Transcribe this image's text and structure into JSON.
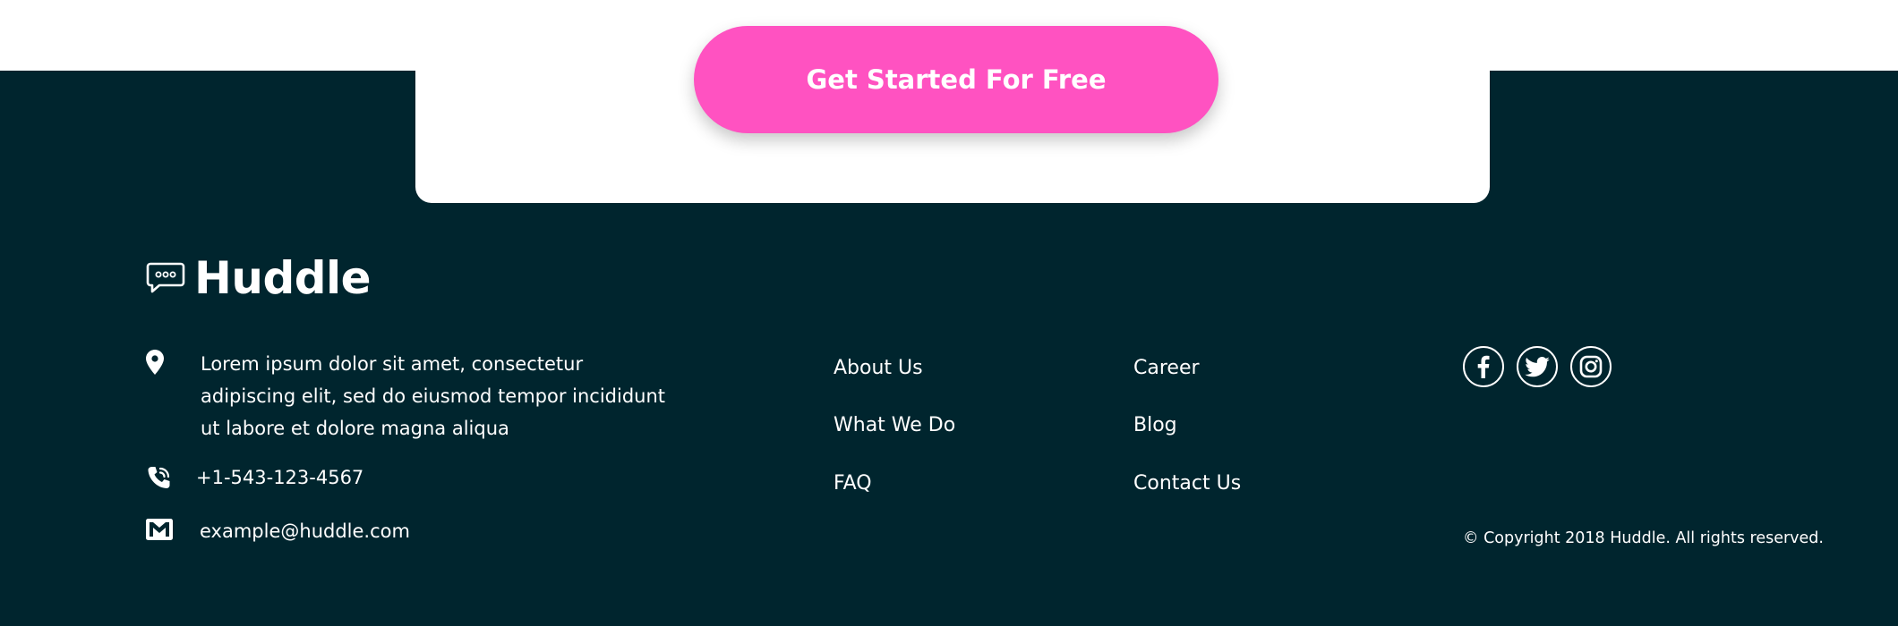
{
  "cta": {
    "button_label": "Get Started For Free"
  },
  "footer": {
    "brand": "Huddle",
    "contact": {
      "address": "Lorem ipsum dolor sit amet, consectetur adipiscing elit, sed do eiusmod tempor incididunt ut labore et dolore magna aliqua",
      "phone": "+1-543-123-4567",
      "email": "example@huddle.com"
    },
    "links_col1": [
      "About Us",
      "What We Do",
      "FAQ"
    ],
    "links_col2": [
      "Career",
      "Blog",
      "Contact Us"
    ],
    "social": [
      "facebook-icon",
      "twitter-icon",
      "instagram-icon"
    ],
    "copyright": "© Copyright 2018 Huddle. All rights reserved."
  },
  "colors": {
    "footer_bg": "#00252e",
    "cta_button": "#ff52c1",
    "card_bg": "#ffffff",
    "text": "#ffffff"
  }
}
